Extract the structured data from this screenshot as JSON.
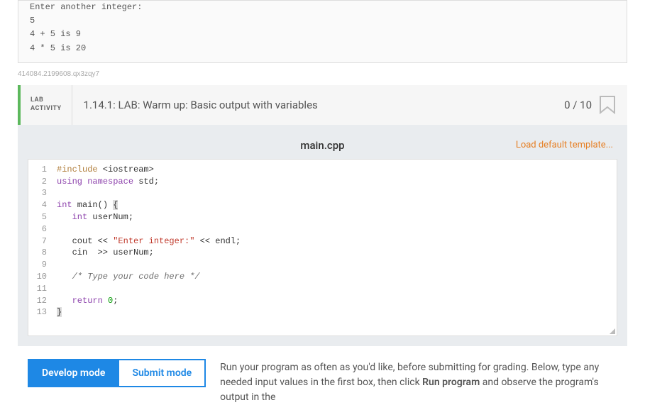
{
  "output": {
    "line1": "Enter another integer:",
    "line2": "5",
    "line3": "4 + 5 is 9",
    "line4": "4 * 5 is 20"
  },
  "watermark": "414084.2199608.qx3zqy7",
  "lab": {
    "badge_line1": "LAB",
    "badge_line2": "ACTIVITY",
    "title": "1.14.1: LAB: Warm up: Basic output with variables",
    "score": "0 / 10"
  },
  "editor": {
    "filename": "main.cpp",
    "load_template": "Load default template...",
    "line_numbers": [
      "1",
      "2",
      "3",
      "4",
      "5",
      "6",
      "7",
      "8",
      "9",
      "10",
      "11",
      "12",
      "13"
    ],
    "code": {
      "l1_include": "#include",
      "l1_header": " <iostream>",
      "l2_using": "using",
      "l2_namespace": "namespace",
      "l2_std": " std;",
      "l4_int": "int",
      "l4_main": " main() ",
      "l4_brace": "{",
      "l5": "   int userNum;",
      "l5_int": "int",
      "l5_var": " userNum;",
      "l7_cout": "   cout << ",
      "l7_str": "\"Enter integer:\"",
      "l7_endl": " << endl;",
      "l8": "   cin  >> userNum;",
      "l10": "   /* Type your code here */",
      "l12_return": "return",
      "l12_zero": "0",
      "l12_semi": ";",
      "l13_brace": "}"
    }
  },
  "modes": {
    "develop": "Develop mode",
    "submit": "Submit mode",
    "description_part1": "Run your program as often as you'd like, before submitting for grading. Below, type any needed input values in the first box, then click ",
    "description_bold": "Run program",
    "description_part2": " and observe the program's output in the"
  }
}
